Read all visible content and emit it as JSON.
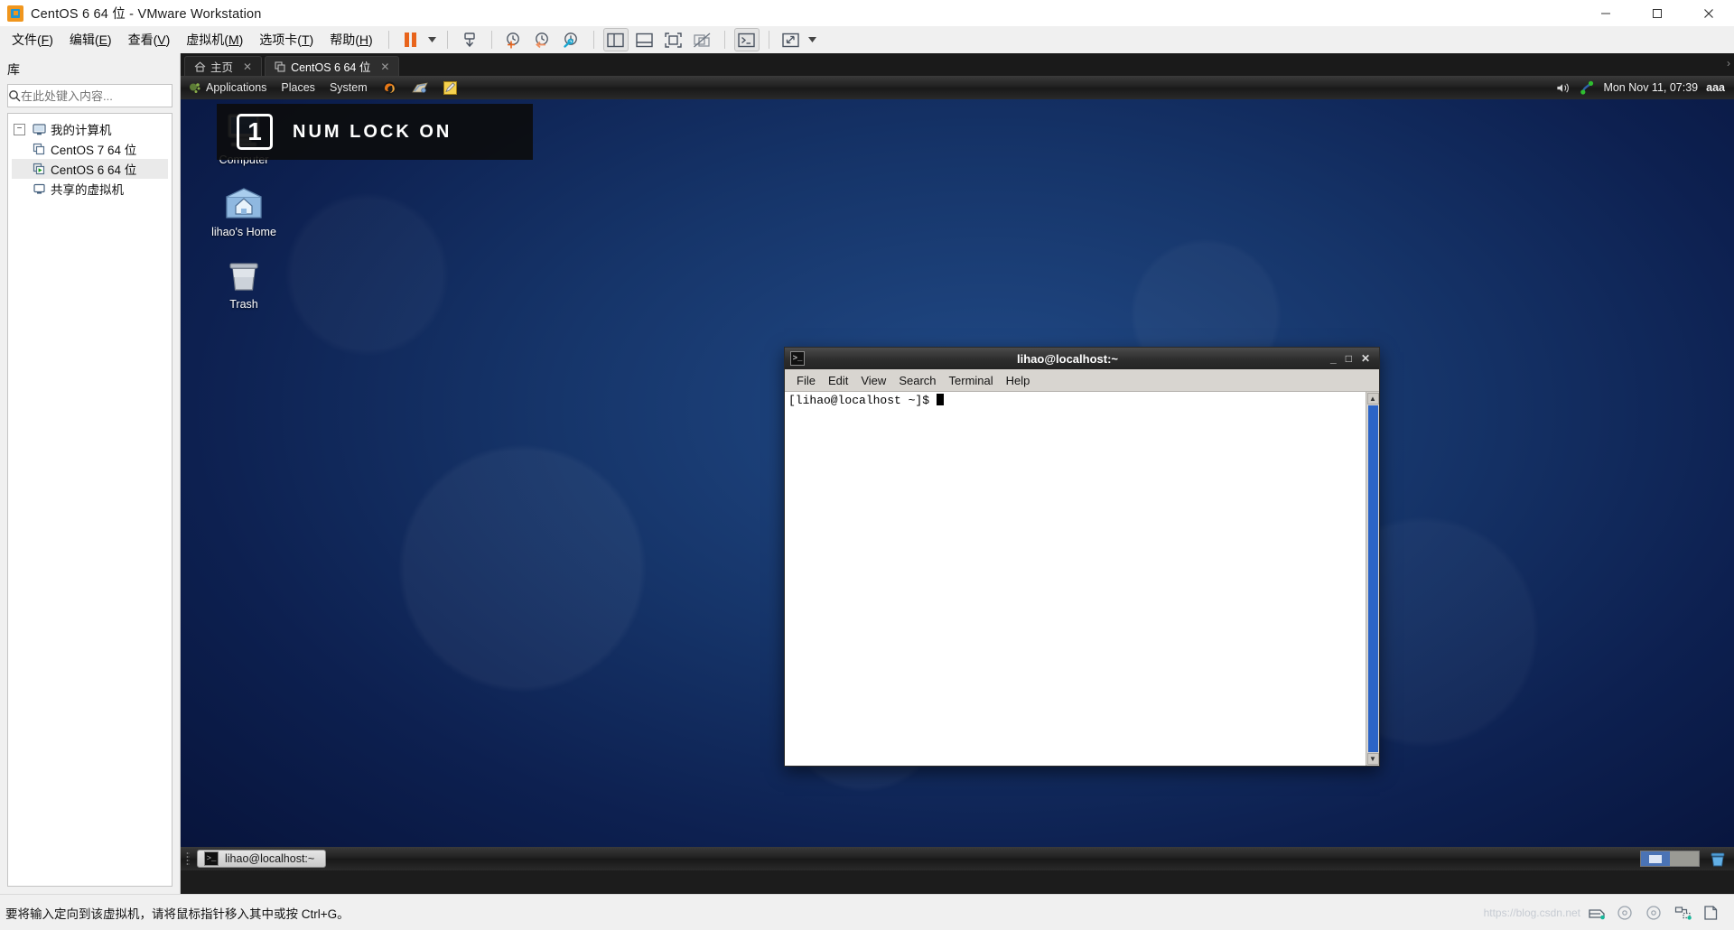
{
  "window": {
    "title": "CentOS 6 64 位 - VMware Workstation",
    "app_icon": "vmware-logo-icon",
    "controls": {
      "minimize": "—",
      "maximize": "☐",
      "close": "✕"
    }
  },
  "menubar": {
    "items": [
      {
        "label": "文件(",
        "mnemonic": "F",
        "tail": ")",
        "name": "menu-file"
      },
      {
        "label": "编辑(",
        "mnemonic": "E",
        "tail": ")",
        "name": "menu-edit"
      },
      {
        "label": "查看(",
        "mnemonic": "V",
        "tail": ")",
        "name": "menu-view"
      },
      {
        "label": "虚拟机(",
        "mnemonic": "M",
        "tail": ")",
        "name": "menu-vm"
      },
      {
        "label": "选项卡(",
        "mnemonic": "T",
        "tail": ")",
        "name": "menu-tabs"
      },
      {
        "label": "帮助(",
        "mnemonic": "H",
        "tail": ")",
        "name": "menu-help"
      }
    ]
  },
  "toolbar": {
    "buttons": [
      {
        "name": "suspend-button",
        "icon": "pause-icon"
      },
      {
        "name": "power-dropdown",
        "icon": "chevron-down-icon"
      },
      {
        "name": "send-ctrl-alt-del-button",
        "icon": "send-key-icon"
      },
      {
        "name": "take-snapshot-button",
        "icon": "snapshot-add-icon"
      },
      {
        "name": "revert-snapshot-button",
        "icon": "snapshot-revert-icon"
      },
      {
        "name": "manage-snapshots-button",
        "icon": "snapshot-manage-icon"
      },
      {
        "name": "show-library-button",
        "icon": "panel-left-icon"
      },
      {
        "name": "show-thumbnail-bar-button",
        "icon": "panel-bottom-icon"
      },
      {
        "name": "fullscreen-button",
        "icon": "fullscreen-icon"
      },
      {
        "name": "unity-mode-button",
        "icon": "unity-icon"
      },
      {
        "name": "console-view-button",
        "icon": "console-icon"
      },
      {
        "name": "stretch-view-button",
        "icon": "stretch-icon"
      },
      {
        "name": "stretch-dropdown",
        "icon": "chevron-down-icon"
      }
    ]
  },
  "sidebar": {
    "title": "库",
    "search": {
      "placeholder": "在此处键入内容...",
      "value": "",
      "icon": "search-icon"
    },
    "tree": [
      {
        "label": "我的计算机",
        "icon": "computer-icon",
        "level": 0,
        "expander": "−",
        "selected": false,
        "name": "tree-item-my-computer"
      },
      {
        "label": "CentOS 7 64 位",
        "icon": "vm-icon",
        "level": 1,
        "selected": false,
        "name": "tree-item-centos7"
      },
      {
        "label": "CentOS 6 64 位",
        "icon": "vm-running-icon",
        "level": 1,
        "selected": true,
        "name": "tree-item-centos6"
      },
      {
        "label": "共享的虚拟机",
        "icon": "shared-vms-icon",
        "level": 0,
        "selected": false,
        "name": "tree-item-shared-vms"
      }
    ]
  },
  "tabs": [
    {
      "label": "主页",
      "icon": "home-icon",
      "active": false,
      "close": "✕",
      "name": "tab-home"
    },
    {
      "label": "CentOS 6 64 位",
      "icon": "vm-icon",
      "active": true,
      "close": "✕",
      "name": "tab-centos6"
    }
  ],
  "overlay": {
    "numlock_digit": "1",
    "numlock_text": "NUM LOCK ON"
  },
  "guest": {
    "panel": {
      "applications": "Applications",
      "places": "Places",
      "system": "System",
      "launchers": [
        {
          "name": "firefox-launcher-icon"
        },
        {
          "name": "evolution-launcher-icon"
        },
        {
          "name": "gedit-launcher-icon"
        }
      ],
      "clock": "Mon Nov 11, 07:39",
      "user": "aaa",
      "tray": [
        {
          "name": "volume-icon"
        },
        {
          "name": "network-icon"
        }
      ]
    },
    "desktop_icons": [
      {
        "label": "Computer",
        "icon": "computer-desktop-icon",
        "name": "desktop-icon-computer"
      },
      {
        "label": "lihao's Home",
        "icon": "home-folder-icon",
        "name": "desktop-icon-home"
      },
      {
        "label": "Trash",
        "icon": "trash-icon",
        "name": "desktop-icon-trash"
      }
    ],
    "taskbar": {
      "window_button": "lihao@localhost:~",
      "window_button_icon": "terminal-icon",
      "workspaces": [
        {
          "active": true
        },
        {
          "active": false
        }
      ],
      "trash_icon": "trash-applet-icon"
    }
  },
  "terminal": {
    "title": "lihao@localhost:~",
    "icon": "terminal-icon",
    "controls": {
      "minimize": "_",
      "maximize": "□",
      "close": "✕"
    },
    "menus": [
      "File",
      "Edit",
      "View",
      "Search",
      "Terminal",
      "Help"
    ],
    "prompt": "[lihao@localhost ~]$ ",
    "scroll": {
      "up": "▲",
      "down": "▼"
    }
  },
  "statusbar": {
    "message": "要将输入定向到该虚拟机，请将鼠标指针移入其中或按 Ctrl+G。",
    "icons": [
      {
        "name": "status-hard-disk-icon"
      },
      {
        "name": "status-cd-dvd-icon"
      },
      {
        "name": "status-cd-dvd-2-icon"
      },
      {
        "name": "status-network-icon"
      },
      {
        "name": "status-usb-icon"
      }
    ],
    "watermark": "https://blog.csdn.net"
  },
  "colors": {
    "accent_orange": "#e8641c",
    "accent_blue": "#2196d3",
    "desktop_blue": "#16356a",
    "selection": "#eaeaea"
  }
}
